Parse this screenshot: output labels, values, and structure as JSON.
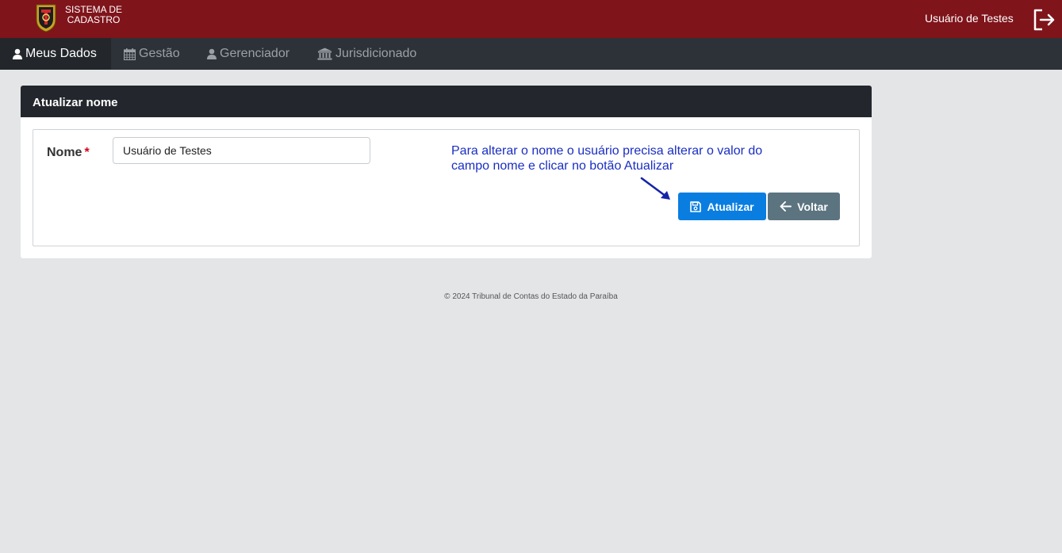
{
  "header": {
    "brand_line1": "SISTEMA DE",
    "brand_line2": "CADASTRO",
    "user_name": "Usuário de Testes",
    "logo_icon": "coat-of-arms-logo",
    "logout_icon": "logout-icon"
  },
  "nav": {
    "items": [
      {
        "label": "Meus Dados",
        "icon": "user-icon",
        "active": true
      },
      {
        "label": "Gestão",
        "icon": "calendar-icon",
        "active": false
      },
      {
        "label": "Gerenciador",
        "icon": "user-icon",
        "active": false
      },
      {
        "label": "Jurisdicionado",
        "icon": "bank-icon",
        "active": false
      }
    ]
  },
  "card": {
    "title": "Atualizar nome",
    "name_label": "Nome",
    "required_mark": "*",
    "name_value": "Usuário de Testes",
    "hint": "Para alterar o nome o usuário precisa alterar o valor do campo nome e clicar no botão Atualizar",
    "update_label": "Atualizar",
    "back_label": "Voltar"
  },
  "footer": {
    "text": "© 2024 Tribunal de Contas do Estado da Paraíba"
  },
  "colors": {
    "header_bg": "#7f141b",
    "nav_bg": "#2d3238",
    "primary": "#0a7ee0",
    "secondary": "#5c7480",
    "hint_text": "#1a2ec2"
  }
}
